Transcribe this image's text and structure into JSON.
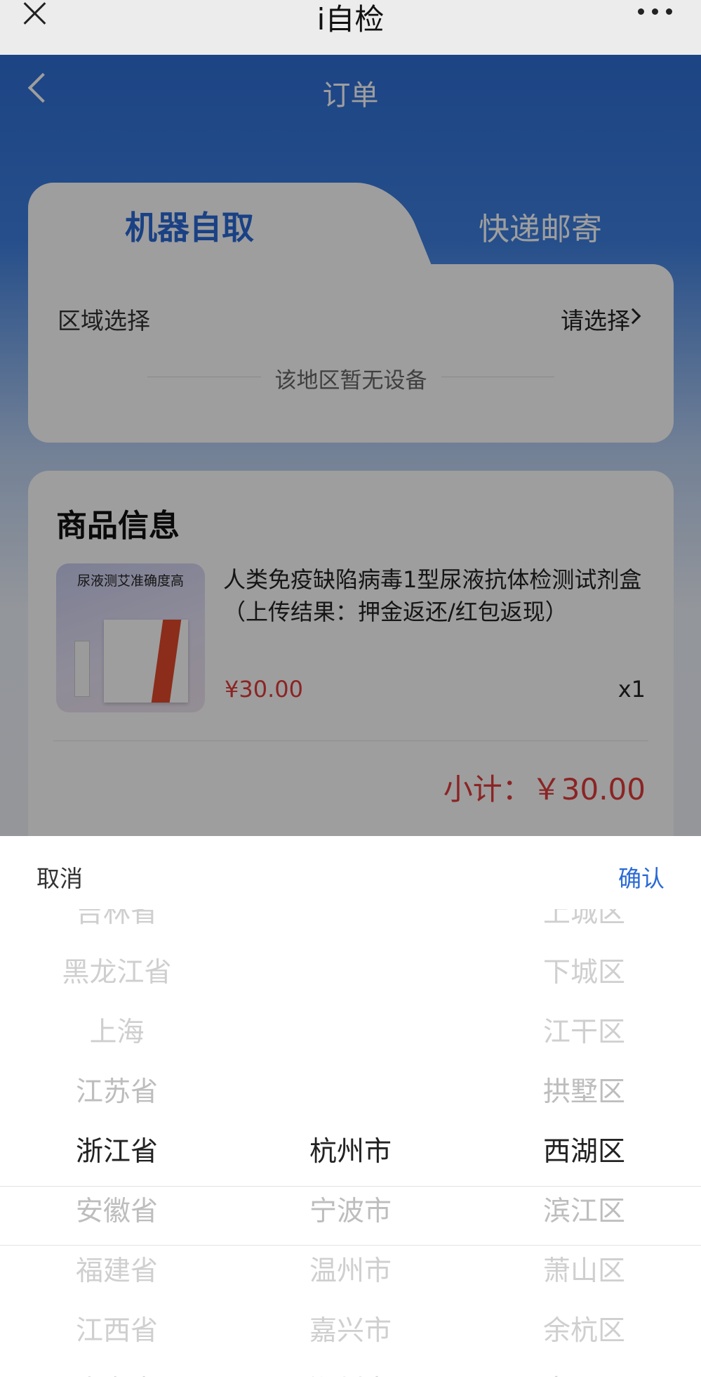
{
  "wechat_bar": {
    "title": "i自检"
  },
  "nav": {
    "title": "订单"
  },
  "tabs": [
    {
      "label": "机器自取",
      "active": true
    },
    {
      "label": "快递邮寄",
      "active": false
    }
  ],
  "region": {
    "label": "区域选择",
    "value": "请选择",
    "empty_notice": "该地区暂无设备"
  },
  "goods": {
    "section_title": "商品信息",
    "thumbnail_text": [
      "尿液测艾准确度高"
    ],
    "name": "人类免疫缺陷病毒1型尿液抗体检测试剂盒（上传结果：押金返还/红包返现）",
    "price": "¥30.00",
    "quantity": "x1",
    "subtotal": "小计：￥30.00"
  },
  "picker": {
    "cancel_label": "取消",
    "confirm_label": "确认",
    "provinces": [
      "吉林省",
      "黑龙江省",
      "上海",
      "江苏省",
      "浙江省",
      "安徽省",
      "福建省",
      "江西省",
      "山东省"
    ],
    "cities": [
      "杭州市",
      "宁波市",
      "温州市",
      "嘉兴市",
      "湖州市"
    ],
    "districts": [
      "上城区",
      "下城区",
      "江干区",
      "拱墅区",
      "西湖区",
      "滨江区",
      "萧山区",
      "余杭区",
      "富阳区"
    ],
    "selected": {
      "province": "浙江省",
      "city": "杭州市",
      "district": "西湖区"
    }
  },
  "colors": {
    "primary": "#2a6ad6",
    "price": "#e03a3a"
  }
}
